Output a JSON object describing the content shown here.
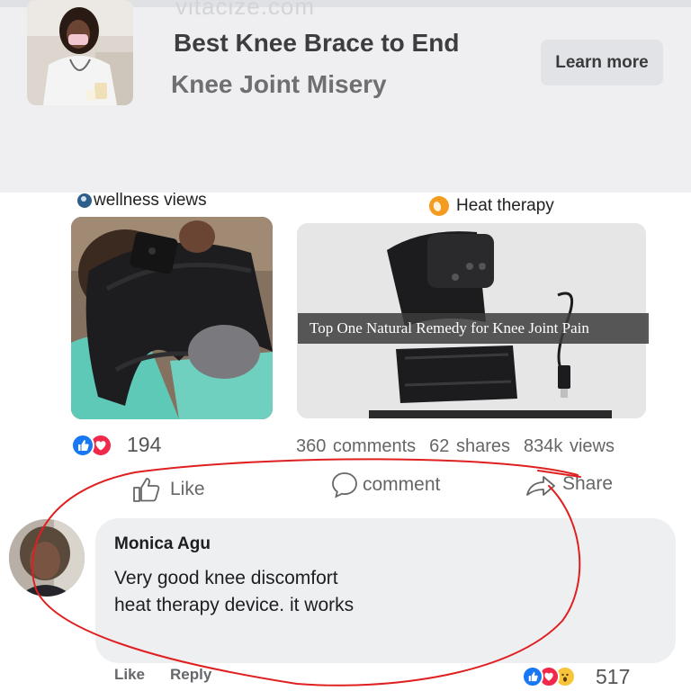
{
  "ad": {
    "watermark": "vitacize.com",
    "title_line1": "Best Knee Brace to End",
    "title_line2": "Knee Joint Misery",
    "cta_label": "Learn more"
  },
  "posts": [
    {
      "page_label": "wellness views"
    },
    {
      "page_label": "Heat therapy",
      "image_caption": "Top One Natural Remedy for Knee Joint Pain"
    }
  ],
  "stats": {
    "reaction_count": "194",
    "comments": "360 comments",
    "shares": "62 shares",
    "views": "834k views"
  },
  "actions": {
    "like": "Like",
    "comment": "comment",
    "share": "Share"
  },
  "comment": {
    "author": "Monica Agu",
    "text_line1": "Very good knee discomfort",
    "text_line2": "heat therapy device. it works",
    "like_label": "Like",
    "reply_label": "Reply",
    "reaction_count": "517"
  },
  "colors": {
    "facebook_blue": "#1877f2",
    "love_red": "#f0284a",
    "annotation_red": "#e02020",
    "ad_background": "#efeff1"
  }
}
